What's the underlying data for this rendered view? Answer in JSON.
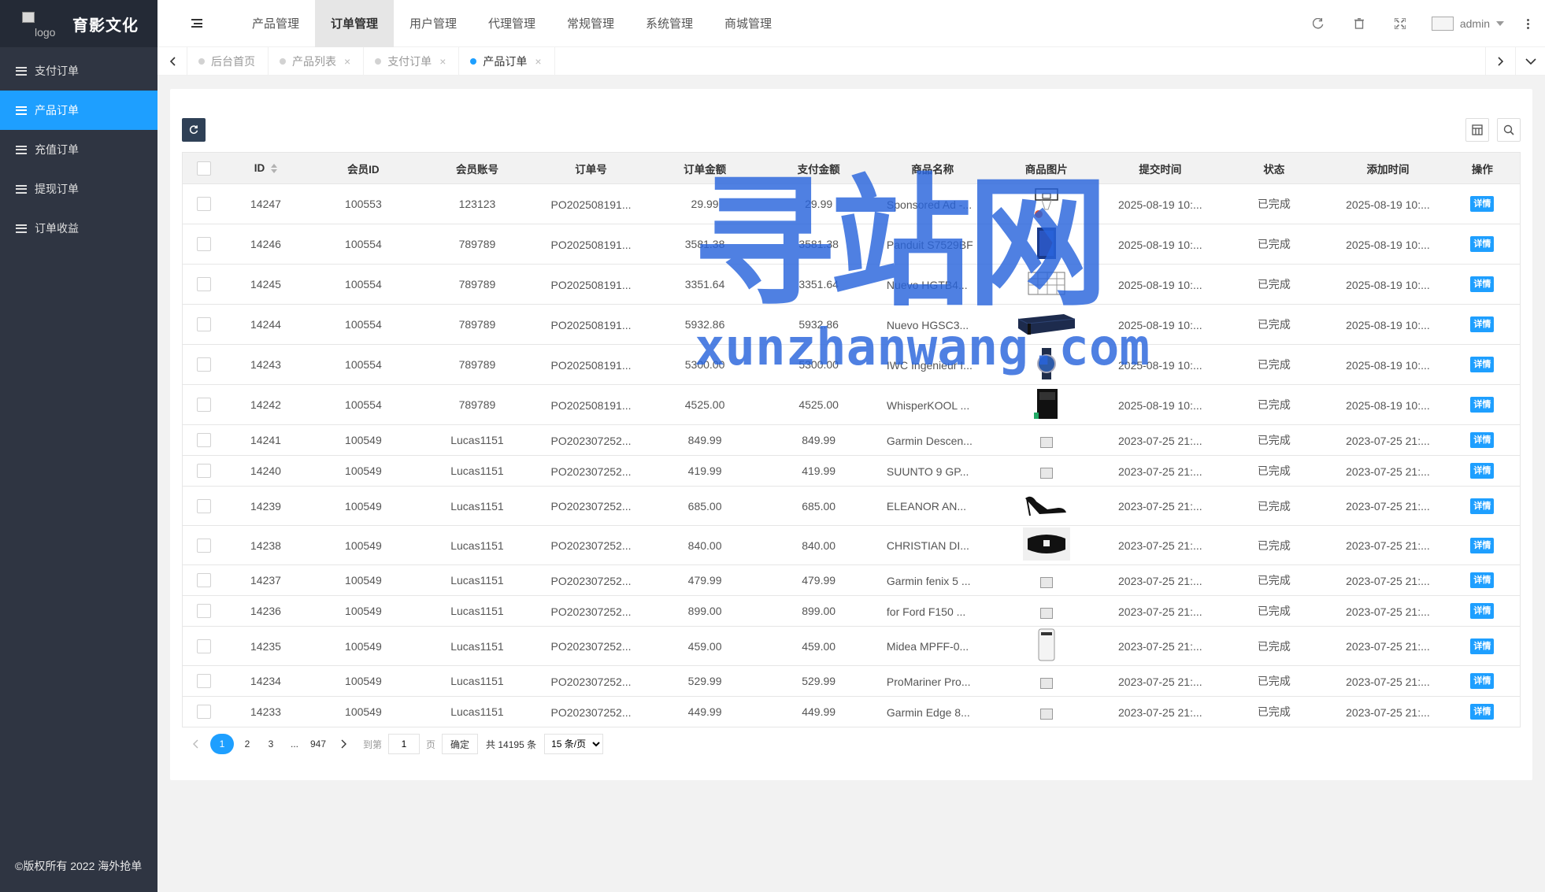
{
  "sidebar": {
    "logo_alt": "logo",
    "brand": "育影文化",
    "items": [
      {
        "label": "支付订单",
        "active": false
      },
      {
        "label": "产品订单",
        "active": true
      },
      {
        "label": "充值订单",
        "active": false
      },
      {
        "label": "提现订单",
        "active": false
      },
      {
        "label": "订单收益",
        "active": false
      }
    ],
    "copyright": "©版权所有 2022 海外抢单"
  },
  "header": {
    "nav": [
      {
        "label": "产品管理",
        "active": false
      },
      {
        "label": "订单管理",
        "active": true
      },
      {
        "label": "用户管理",
        "active": false
      },
      {
        "label": "代理管理",
        "active": false
      },
      {
        "label": "常规管理",
        "active": false
      },
      {
        "label": "系统管理",
        "active": false
      },
      {
        "label": "商城管理",
        "active": false
      }
    ],
    "user": "admin"
  },
  "tabs": [
    {
      "label": "后台首页",
      "closable": false,
      "active": false
    },
    {
      "label": "产品列表",
      "closable": true,
      "active": false
    },
    {
      "label": "支付订单",
      "closable": true,
      "active": false
    },
    {
      "label": "产品订单",
      "closable": true,
      "active": true
    }
  ],
  "table": {
    "columns": [
      "ID",
      "会员ID",
      "会员账号",
      "订单号",
      "订单金额",
      "支付金额",
      "商品名称",
      "商品图片",
      "提交时间",
      "状态",
      "添加时间",
      "操作"
    ],
    "action_label": "详情",
    "rows": [
      {
        "id": "14247",
        "member_id": "100553",
        "account": "123123",
        "order_no": "PO202508191...",
        "amount": "29.99",
        "paid": "29.99",
        "name": "Sponsored Ad -...",
        "image": "basketball-hoop",
        "submitted": "2025-08-19 10:...",
        "status": "已完成",
        "added": "2025-08-19 10:..."
      },
      {
        "id": "14246",
        "member_id": "100554",
        "account": "789789",
        "order_no": "PO202508191...",
        "amount": "3581.38",
        "paid": "3581.38",
        "name": "Panduit S7529BF",
        "image": "server-cabinet",
        "submitted": "2025-08-19 10:...",
        "status": "已完成",
        "added": "2025-08-19 10:..."
      },
      {
        "id": "14245",
        "member_id": "100554",
        "account": "789789",
        "order_no": "PO202508191...",
        "amount": "3351.64",
        "paid": "3351.64",
        "name": "Nuevo HGTB4...",
        "image": "wire-rack",
        "submitted": "2025-08-19 10:...",
        "status": "已完成",
        "added": "2025-08-19 10:..."
      },
      {
        "id": "14244",
        "member_id": "100554",
        "account": "789789",
        "order_no": "PO202508191...",
        "amount": "5932.86",
        "paid": "5932.86",
        "name": "Nuevo HGSC3...",
        "image": "sofa",
        "submitted": "2025-08-19 10:...",
        "status": "已完成",
        "added": "2025-08-19 10:..."
      },
      {
        "id": "14243",
        "member_id": "100554",
        "account": "789789",
        "order_no": "PO202508191...",
        "amount": "5300.00",
        "paid": "5300.00",
        "name": "IWC Ingenieur I...",
        "image": "watch",
        "submitted": "2025-08-19 10:...",
        "status": "已完成",
        "added": "2025-08-19 10:..."
      },
      {
        "id": "14242",
        "member_id": "100554",
        "account": "789789",
        "order_no": "PO202508191...",
        "amount": "4525.00",
        "paid": "4525.00",
        "name": "WhisperKOOL ...",
        "image": "cooler",
        "submitted": "2025-08-19 10:...",
        "status": "已完成",
        "added": "2025-08-19 10:..."
      },
      {
        "id": "14241",
        "member_id": "100549",
        "account": "Lucas1151",
        "order_no": "PO202307252...",
        "amount": "849.99",
        "paid": "849.99",
        "name": "Garmin Descen...",
        "image": "broken",
        "submitted": "2023-07-25 21:...",
        "status": "已完成",
        "added": "2023-07-25 21:..."
      },
      {
        "id": "14240",
        "member_id": "100549",
        "account": "Lucas1151",
        "order_no": "PO202307252...",
        "amount": "419.99",
        "paid": "419.99",
        "name": "SUUNTO 9 GP...",
        "image": "broken",
        "submitted": "2023-07-25 21:...",
        "status": "已完成",
        "added": "2023-07-25 21:..."
      },
      {
        "id": "14239",
        "member_id": "100549",
        "account": "Lucas1151",
        "order_no": "PO202307252...",
        "amount": "685.00",
        "paid": "685.00",
        "name": "ELEANOR AN...",
        "image": "heels",
        "submitted": "2023-07-25 21:...",
        "status": "已完成",
        "added": "2023-07-25 21:..."
      },
      {
        "id": "14238",
        "member_id": "100549",
        "account": "Lucas1151",
        "order_no": "PO202307252...",
        "amount": "840.00",
        "paid": "840.00",
        "name": "CHRISTIAN DI...",
        "image": "bag",
        "submitted": "2023-07-25 21:...",
        "status": "已完成",
        "added": "2023-07-25 21:..."
      },
      {
        "id": "14237",
        "member_id": "100549",
        "account": "Lucas1151",
        "order_no": "PO202307252...",
        "amount": "479.99",
        "paid": "479.99",
        "name": "Garmin fenix 5 ...",
        "image": "broken",
        "submitted": "2023-07-25 21:...",
        "status": "已完成",
        "added": "2023-07-25 21:..."
      },
      {
        "id": "14236",
        "member_id": "100549",
        "account": "Lucas1151",
        "order_no": "PO202307252...",
        "amount": "899.00",
        "paid": "899.00",
        "name": "for Ford F150 ...",
        "image": "broken",
        "submitted": "2023-07-25 21:...",
        "status": "已完成",
        "added": "2023-07-25 21:..."
      },
      {
        "id": "14235",
        "member_id": "100549",
        "account": "Lucas1151",
        "order_no": "PO202307252...",
        "amount": "459.00",
        "paid": "459.00",
        "name": "Midea MPFF-0...",
        "image": "air-conditioner",
        "submitted": "2023-07-25 21:...",
        "status": "已完成",
        "added": "2023-07-25 21:..."
      },
      {
        "id": "14234",
        "member_id": "100549",
        "account": "Lucas1151",
        "order_no": "PO202307252...",
        "amount": "529.99",
        "paid": "529.99",
        "name": "ProMariner Pro...",
        "image": "broken",
        "submitted": "2023-07-25 21:...",
        "status": "已完成",
        "added": "2023-07-25 21:..."
      },
      {
        "id": "14233",
        "member_id": "100549",
        "account": "Lucas1151",
        "order_no": "PO202307252...",
        "amount": "449.99",
        "paid": "449.99",
        "name": "Garmin Edge 8...",
        "image": "broken",
        "submitted": "2023-07-25 21:...",
        "status": "已完成",
        "added": "2023-07-25 21:..."
      }
    ]
  },
  "pagination": {
    "prev": "<",
    "pages": [
      "1",
      "2",
      "3"
    ],
    "ellipsis": "...",
    "last": "947",
    "next": ">",
    "goto_label": "到第",
    "goto_value": "1",
    "page_unit": "页",
    "confirm": "确定",
    "total": "共 14195 条",
    "per_page": "15 条/页"
  },
  "watermark": {
    "cn": "寻站网",
    "en": "xunzhanwang.com"
  },
  "colors": {
    "accent": "#1e9fff",
    "sidebar_bg": "#2f3542",
    "watermark": "#2864dc"
  }
}
